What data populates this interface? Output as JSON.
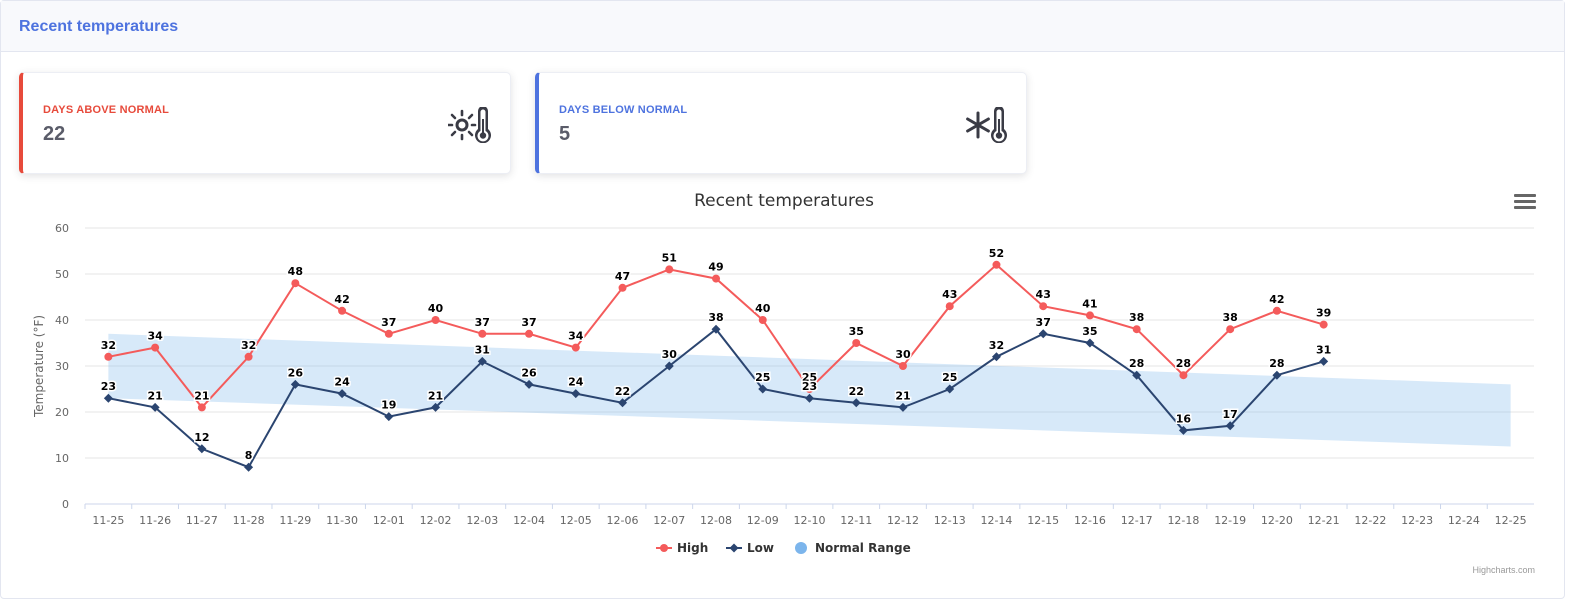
{
  "header": {
    "title": "Recent temperatures"
  },
  "cards": [
    {
      "label": "DAYS ABOVE NORMAL",
      "value": "22",
      "icon": "sun-thermometer-icon",
      "color": "#e74a3b"
    },
    {
      "label": "DAYS BELOW NORMAL",
      "value": "5",
      "icon": "snowflake-thermometer-icon",
      "color": "#4e73df"
    }
  ],
  "credits": "Highcharts.com",
  "chart_data": {
    "type": "line",
    "title": "Recent temperatures",
    "ylabel": "Temperature (°F)",
    "xlabel": "",
    "ylim": [
      0,
      60
    ],
    "yticks": [
      0,
      10,
      20,
      30,
      40,
      50,
      60
    ],
    "categories": [
      "11-25",
      "11-26",
      "11-27",
      "11-28",
      "11-29",
      "11-30",
      "12-01",
      "12-02",
      "12-03",
      "12-04",
      "12-05",
      "12-06",
      "12-07",
      "12-08",
      "12-09",
      "12-10",
      "12-11",
      "12-12",
      "12-13",
      "12-14",
      "12-15",
      "12-16",
      "12-17",
      "12-18",
      "12-19",
      "12-20",
      "12-21",
      "12-22",
      "12-23",
      "12-24",
      "12-25"
    ],
    "series": [
      {
        "name": "High",
        "color": "#f45b5b",
        "marker": "circle",
        "values": [
          32,
          34,
          21,
          32,
          48,
          42,
          37,
          40,
          37,
          37,
          34,
          47,
          51,
          49,
          40,
          25,
          35,
          30,
          43,
          52,
          43,
          41,
          38,
          28,
          38,
          42,
          39
        ]
      },
      {
        "name": "Low",
        "color": "#2b4570",
        "marker": "diamond",
        "values": [
          23,
          21,
          12,
          8,
          26,
          24,
          19,
          21,
          31,
          26,
          24,
          22,
          30,
          38,
          25,
          23,
          22,
          21,
          25,
          32,
          37,
          35,
          28,
          16,
          17,
          28,
          31
        ]
      },
      {
        "name": "Normal Range",
        "color": "#7cb5ec",
        "type": "arearange",
        "upper_start": 37,
        "upper_end": 26,
        "lower_start": 23,
        "lower_end": 12.5
      }
    ],
    "legend": "bottom-center",
    "grid": true
  }
}
